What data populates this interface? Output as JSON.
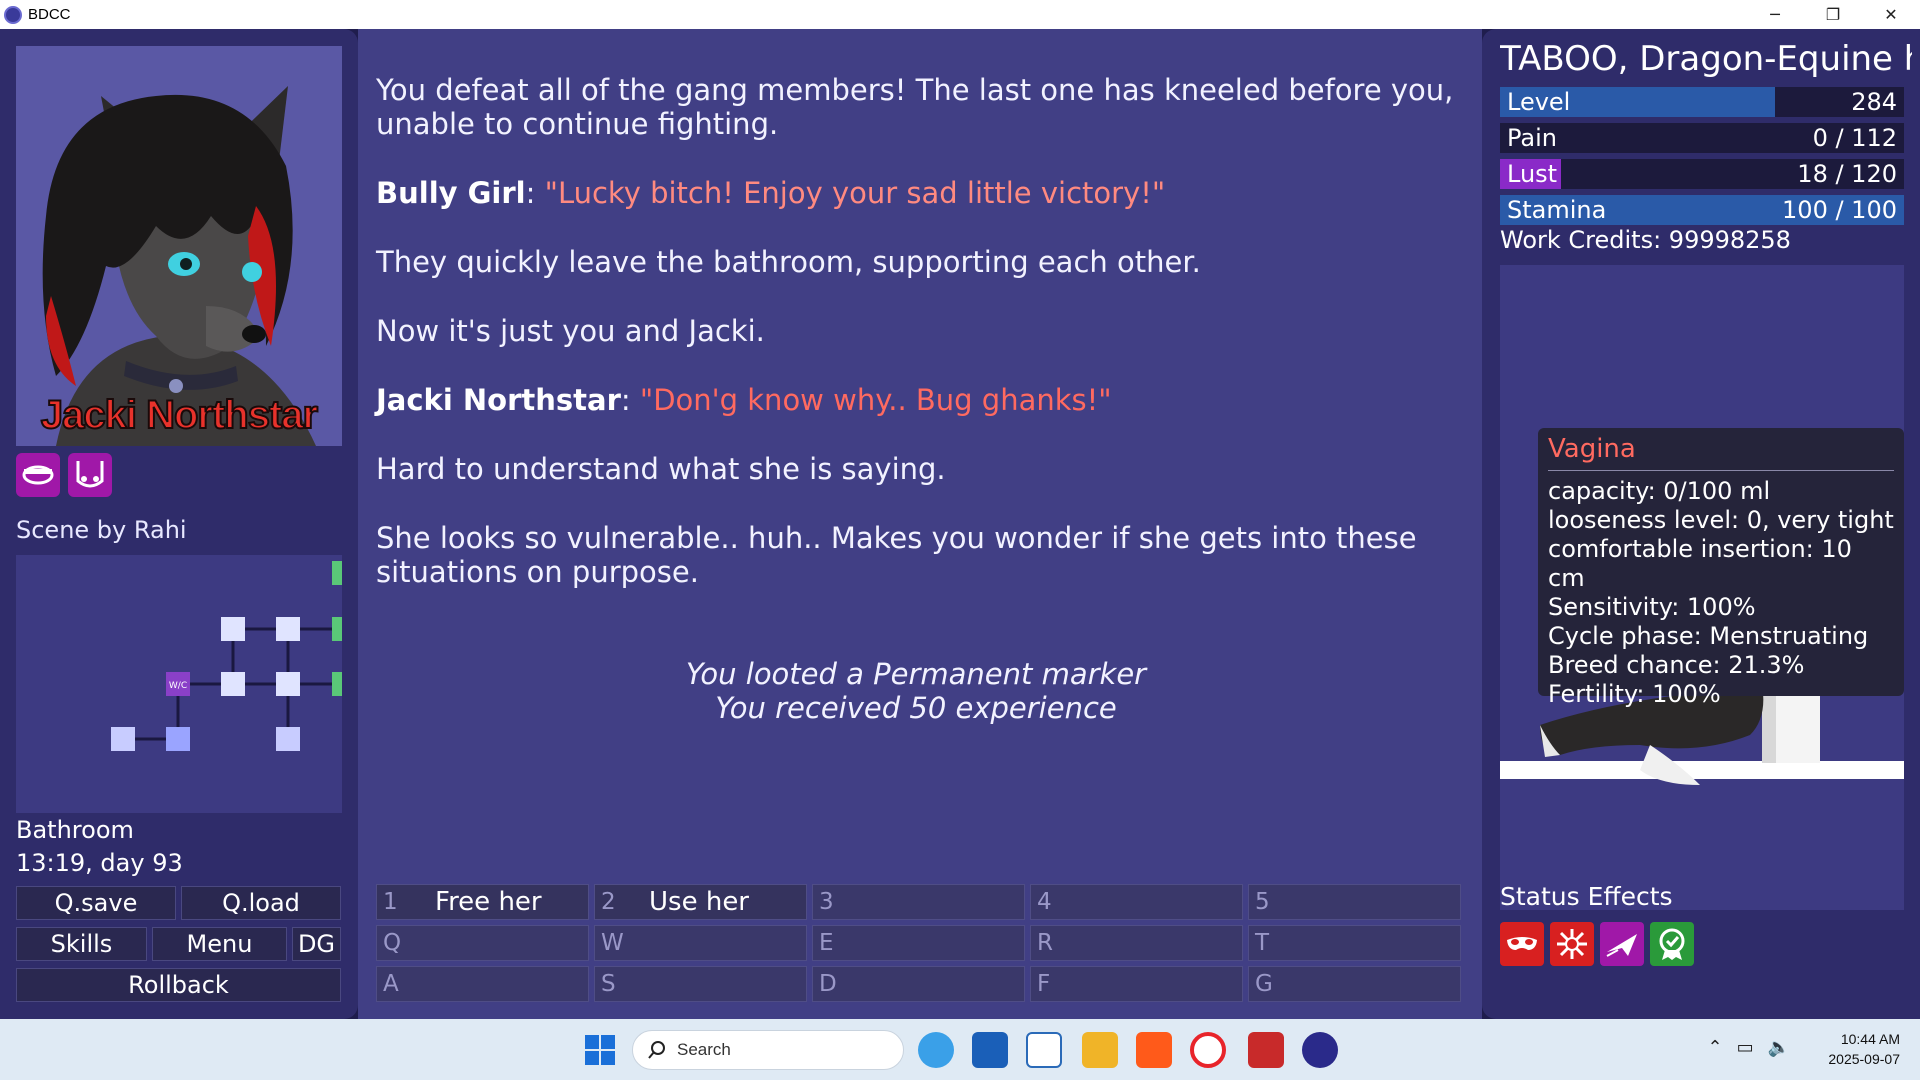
{
  "window": {
    "title": "BDCC",
    "controls": {
      "minimize": "─",
      "maximize": "❐",
      "close": "✕"
    }
  },
  "left": {
    "portrait_name": "Jacki Northstar",
    "scene_by": "Scene by Rahi",
    "location": "Bathroom",
    "time": "13:19, day 93",
    "minimap_room_label": "W/C",
    "buttons": {
      "qsave": "Q.save",
      "qload": "Q.load",
      "skills": "Skills",
      "menu": "Menu",
      "dg": "DG",
      "rollback": "Rollback"
    }
  },
  "story": {
    "p1": "You defeat all of the gang members! The last one has kneeled before you, unable to continue fighting.",
    "p2_speaker": "Bully Girl",
    "p2_quote": "\"Lucky bitch! Enjoy your sad little victory!\"",
    "p3": "They quickly leave the bathroom, supporting each other.",
    "p4": "Now it's just you and Jacki.",
    "p5_speaker": "Jacki Northstar",
    "p5_quote": "\"Don'g know why.. Bug ghanks!\"",
    "p6": "Hard to understand what she is saying.",
    "p7": "She looks so vulnerable.. huh.. Makes you wonder if she gets into these situations on purpose.",
    "loot1": "You looted a Permanent marker",
    "loot2": "You received 50 experience"
  },
  "actions": [
    {
      "key": "1",
      "label": "Free her"
    },
    {
      "key": "2",
      "label": "Use her"
    },
    {
      "key": "3",
      "label": ""
    },
    {
      "key": "4",
      "label": ""
    },
    {
      "key": "5",
      "label": ""
    },
    {
      "key": "Q",
      "label": ""
    },
    {
      "key": "W",
      "label": ""
    },
    {
      "key": "E",
      "label": ""
    },
    {
      "key": "R",
      "label": ""
    },
    {
      "key": "T",
      "label": ""
    },
    {
      "key": "A",
      "label": ""
    },
    {
      "key": "S",
      "label": ""
    },
    {
      "key": "D",
      "label": ""
    },
    {
      "key": "F",
      "label": ""
    },
    {
      "key": "G",
      "label": ""
    }
  ],
  "right": {
    "title": "TABOO, Dragon-Equine h",
    "stats": {
      "level_label": "Level",
      "level_value": "284",
      "pain_label": "Pain",
      "pain_value": "0 / 112",
      "lust_label": "Lust",
      "lust_value": "18 / 120",
      "stamina_label": "Stamina",
      "stamina_value": "100 / 100"
    },
    "stat_fill": {
      "level": 0.68,
      "pain": 0,
      "lust": 0.15,
      "stamina": 1
    },
    "credits": "Work Credits: 99998258",
    "tooltip": {
      "title": "Vagina",
      "lines": [
        "capacity: 0/100 ml",
        "looseness level: 0, very tight",
        "comfortable insertion: 10 cm",
        "Sensitivity: 100%",
        "Cycle phase: Menstruating",
        "Breed chance: 21.3%",
        "Fertility: 100%"
      ]
    },
    "status_title": "Status Effects"
  },
  "colors": {
    "level_bar": "#2a5aa8",
    "pain_bar": "#6a2a2a",
    "lust_bar": "#8a2ac8",
    "stamina_bar": "#2a5aa8",
    "status_red": "#d82020",
    "status_magenta": "#a018a8",
    "status_green": "#2a9a3a"
  },
  "taskbar": {
    "search_placeholder": "Search",
    "clock_time": "10:44 AM",
    "clock_date": "2025-09-07"
  }
}
